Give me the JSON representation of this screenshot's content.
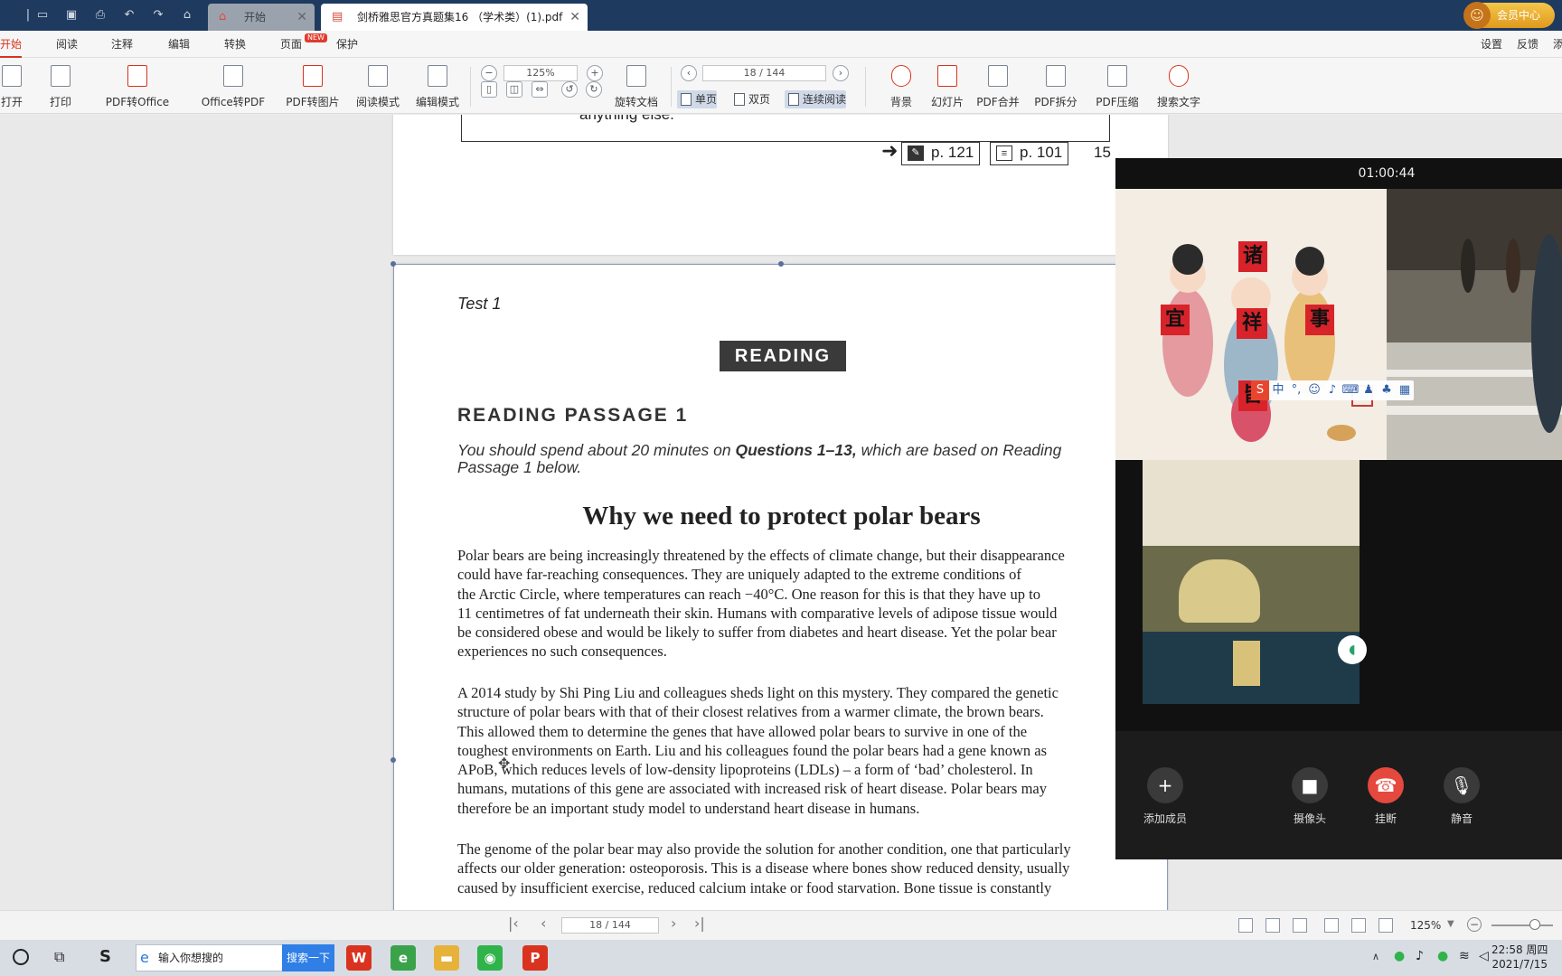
{
  "titlebar": {
    "tabs": [
      {
        "label": "开始"
      },
      {
        "label": "剑桥雅思官方真题集16 （学术类）(1).pdf"
      }
    ],
    "member_label": "会员中心"
  },
  "menubar": {
    "items": [
      "开始",
      "阅读",
      "注释",
      "编辑",
      "转换",
      "页面",
      "保护"
    ],
    "new_badge": "NEW",
    "right_items": [
      "设置",
      "反馈",
      "添"
    ]
  },
  "ribbon": {
    "buttons": [
      "打开",
      "打印",
      "PDF转Office",
      "Office转PDF",
      "PDF转图片",
      "阅读模式",
      "编辑模式",
      "旋转文档",
      "背景",
      "幻灯片",
      "PDF合并",
      "PDF拆分",
      "PDF压缩",
      "搜索文字"
    ],
    "zoom_value": "125%",
    "page_value": "18 / 144",
    "view_modes": [
      "单页",
      "双页",
      "连续阅读"
    ]
  },
  "document": {
    "prev_page_text": "anything else.",
    "ref1": "p. 121",
    "ref2": "p. 101",
    "page_number": "15",
    "test_label": "Test 1",
    "reading_heading": "READING",
    "passage_title": "READING PASSAGE 1",
    "instructions_pre": "You should spend about 20 minutes on ",
    "instructions_bold": "Questions 1–13,",
    "instructions_post": " which are based on Reading Passage 1 below.",
    "article_title": "Why we need to protect polar bears",
    "paragraphs": [
      "Polar bears are being increasingly threatened by the effects of climate change, but their disappearance\ncould have far-reaching consequences. They are uniquely adapted to the extreme conditions of\nthe Arctic Circle, where temperatures can reach −40°C. One reason for this is that they have up to\n11 centimetres of fat underneath their skin. Humans with comparative levels of adipose tissue would\nbe considered obese and would be likely to suffer from diabetes and heart disease. Yet the polar bear\nexperiences no such consequences.",
      "A 2014 study by Shi Ping Liu and colleagues sheds light on this mystery. They compared the genetic\nstructure of polar bears with that of their closest relatives from a warmer climate, the brown bears.\nThis allowed them to determine the genes that have allowed polar bears to survive in one of the\ntoughest environments on Earth. Liu and his colleagues found the polar bears had a gene known as\nAPoB, which reduces levels of low-density lipoproteins (LDLs) – a form of ‘bad’ cholesterol. In\nhumans, mutations of this gene are associated with increased risk of heart disease. Polar bears may\ntherefore be an important study model to understand heart disease in humans.",
      "The genome of the polar bear may also provide the solution for another condition, one that particularly\naffects our older generation: osteoporosis. This is a disease where bones show reduced density, usually\ncaused by insufficient exercise, reduced calcium intake or food starvation. Bone tissue is constantly"
    ]
  },
  "call": {
    "timer": "01:00:44",
    "art_chars": [
      "诸",
      "宜",
      "祥",
      "事",
      "皆"
    ],
    "controls": [
      "添加成员",
      "摄像头",
      "挂断",
      "静音"
    ]
  },
  "statusbar": {
    "page_value": "18 / 144",
    "zoom_value": "125%"
  },
  "taskbar": {
    "search_placeholder": "输入你想搜的",
    "search_button": "搜索一下",
    "time": "22:58 周四",
    "date": "2021/7/15"
  }
}
